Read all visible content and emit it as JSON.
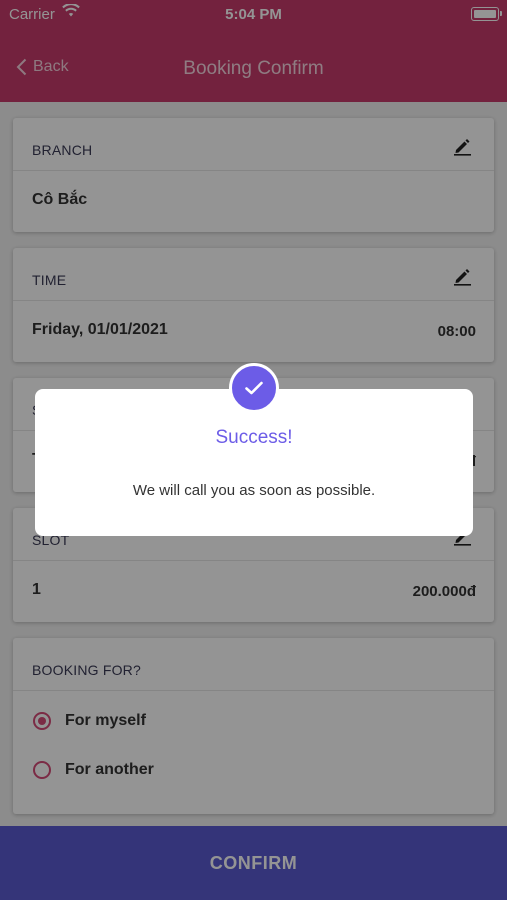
{
  "status_bar": {
    "carrier": "Carrier",
    "time": "5:04 PM"
  },
  "nav": {
    "back_label": "Back",
    "title": "Booking Confirm"
  },
  "branch": {
    "label": "BRANCH",
    "value": "Cô Bắc"
  },
  "time_card": {
    "label": "TIME",
    "date": "Friday,  01/01/2021",
    "hour": "08:00"
  },
  "service_card": {
    "label": "S",
    "value": "T",
    "right": "đ"
  },
  "slot": {
    "label": "SLOT",
    "value": "1",
    "price": "200.000đ"
  },
  "booking_for": {
    "label": "BOOKING FOR?",
    "options": [
      {
        "label": "For myself",
        "selected": true
      },
      {
        "label": "For another",
        "selected": false
      }
    ]
  },
  "confirm_label": "CONFIRM",
  "dialog": {
    "title": "Success!",
    "message": "We will call you as soon as possible."
  },
  "colors": {
    "header": "#c63c6b",
    "confirm": "#5b5bd0",
    "accent": "#6c5ce7",
    "radio": "#d44a77"
  },
  "icons": [
    "wifi-icon",
    "battery-icon",
    "back-chevron-icon",
    "edit-icon",
    "check-icon",
    "radio-icon"
  ]
}
